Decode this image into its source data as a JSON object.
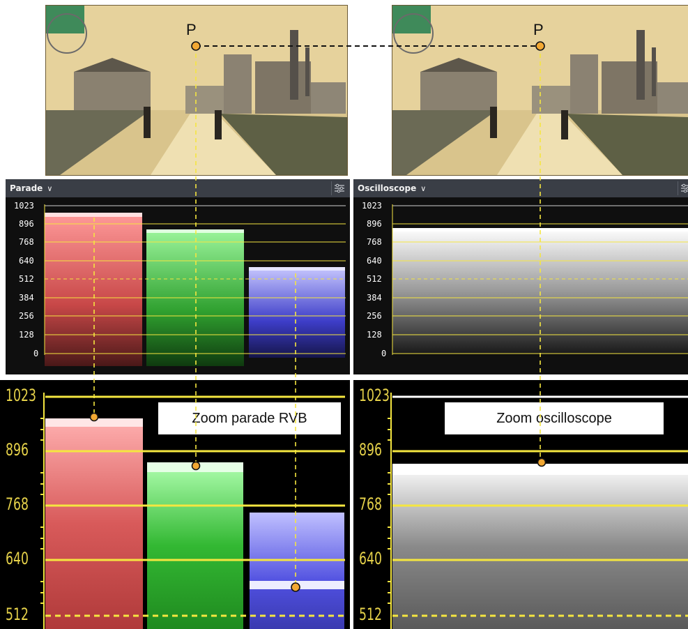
{
  "top": {
    "point_label_left": "P",
    "point_label_right": "P"
  },
  "parade_panel": {
    "title": "Parade",
    "chevron": "chevron-down-icon",
    "settings_icon": "sliders-icon",
    "scale": [
      "1023",
      "896",
      "768",
      "640",
      "512",
      "384",
      "256",
      "128",
      "0"
    ]
  },
  "oscilloscope_panel": {
    "title": "Oscilloscope",
    "chevron": "chevron-down-icon",
    "settings_icon": "sliders-icon",
    "scale": [
      "1023",
      "896",
      "768",
      "640",
      "512",
      "384",
      "256",
      "128",
      "0"
    ]
  },
  "zoom_parade": {
    "caption": "Zoom parade RVB",
    "scale": [
      "1023",
      "896",
      "768",
      "640",
      "512"
    ]
  },
  "zoom_oscilloscope": {
    "caption": "Zoom oscilloscope",
    "scale": [
      "1023",
      "896",
      "768",
      "640",
      "512"
    ]
  },
  "colors": {
    "guide": "#f5e640",
    "marker_fill": "#f2a833",
    "red": "#ff6a6a",
    "green": "#4ddc4d",
    "blue": "#6a6aff"
  }
}
